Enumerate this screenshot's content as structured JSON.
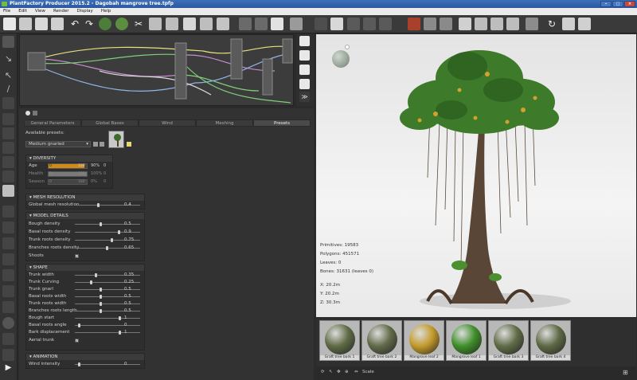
{
  "window": {
    "title": "PlantFactory Producer 2015.2 - Dagobah mangrove tree.tpfp"
  },
  "menu": [
    "File",
    "Edit",
    "View",
    "Render",
    "Display",
    "Help"
  ],
  "tabs": [
    "General Parameters",
    "Global Bases",
    "Wind",
    "Meshing",
    "Presets"
  ],
  "presets": {
    "label": "Available presets:",
    "selected": "Medium gnarled"
  },
  "diversity": {
    "title": "DIVERSITY",
    "rows": [
      {
        "name": "Age",
        "min": "0",
        "max": "100",
        "pct": "90%",
        "extra": "0"
      },
      {
        "name": "Health",
        "min": "0",
        "max": "100",
        "pct": "100%",
        "extra": "0"
      },
      {
        "name": "Season",
        "min": "0",
        "max": "180",
        "pct": "0%",
        "extra": "0"
      }
    ]
  },
  "mesh": {
    "title": "MESH RESOLUTION",
    "rows": [
      {
        "name": "Global mesh resolution",
        "value": "0.4",
        "level": 0.4
      }
    ]
  },
  "model": {
    "title": "MODEL DETAILS",
    "rows": [
      {
        "name": "Bough density",
        "value": "0.5",
        "level": 0.5
      },
      {
        "name": "Basal roots density",
        "value": "0.9",
        "level": 0.9
      },
      {
        "name": "Trunk roots density",
        "value": "0.75",
        "level": 0.75
      },
      {
        "name": "Branches roots density",
        "value": "0.65",
        "level": 0.65
      }
    ],
    "shoots_label": "Shoots"
  },
  "shape": {
    "title": "SHAPE",
    "rows": [
      {
        "name": "Trunk width",
        "value": "0.35",
        "level": 0.35
      },
      {
        "name": "Trunk Curving",
        "value": "0.25",
        "level": 0.25
      },
      {
        "name": "Trunk gnarl",
        "value": "0.5",
        "level": 0.5
      },
      {
        "name": "Basal roots width",
        "value": "0.5",
        "level": 0.5
      },
      {
        "name": "Trunk roots width",
        "value": "0.5",
        "level": 0.5
      },
      {
        "name": "Branches roots length",
        "value": "0.5",
        "level": 0.5
      },
      {
        "name": "Bough start",
        "value": "1",
        "level": 1.0
      },
      {
        "name": "Basal roots angle",
        "value": "0",
        "level": 0.0
      },
      {
        "name": "Bark displacement",
        "value": "1",
        "level": 1.0
      }
    ],
    "aerial_label": "Aerial trunk"
  },
  "animation": {
    "title": "ANIMATION",
    "rows": [
      {
        "name": "Wind intensity",
        "value": "0",
        "level": 0.0
      }
    ]
  },
  "viewport_stats": {
    "primitives": "Primitives: 19583",
    "polygons": "Polygons: 451571",
    "leaves": "Leaves: 0",
    "bones": "Bones: 31631 (leaves 0)",
    "x": "X: 20.2m",
    "y": "Y: 20.2m",
    "z": "Z: 30.3m"
  },
  "materials": [
    {
      "label": "Graft tree bark 1",
      "color": "#5f6b44"
    },
    {
      "label": "Graft tree bark 2",
      "color": "#616a48"
    },
    {
      "label": "Mangrove leaf 2",
      "color": "#c49a2a"
    },
    {
      "label": "Mangrove leaf 1",
      "color": "#3f8f2a"
    },
    {
      "label": "Graft tree bark 3",
      "color": "#606c47"
    },
    {
      "label": "Graft tree bark 4",
      "color": "#5e6945"
    }
  ],
  "bottom": {
    "scale_label": "Scale"
  }
}
